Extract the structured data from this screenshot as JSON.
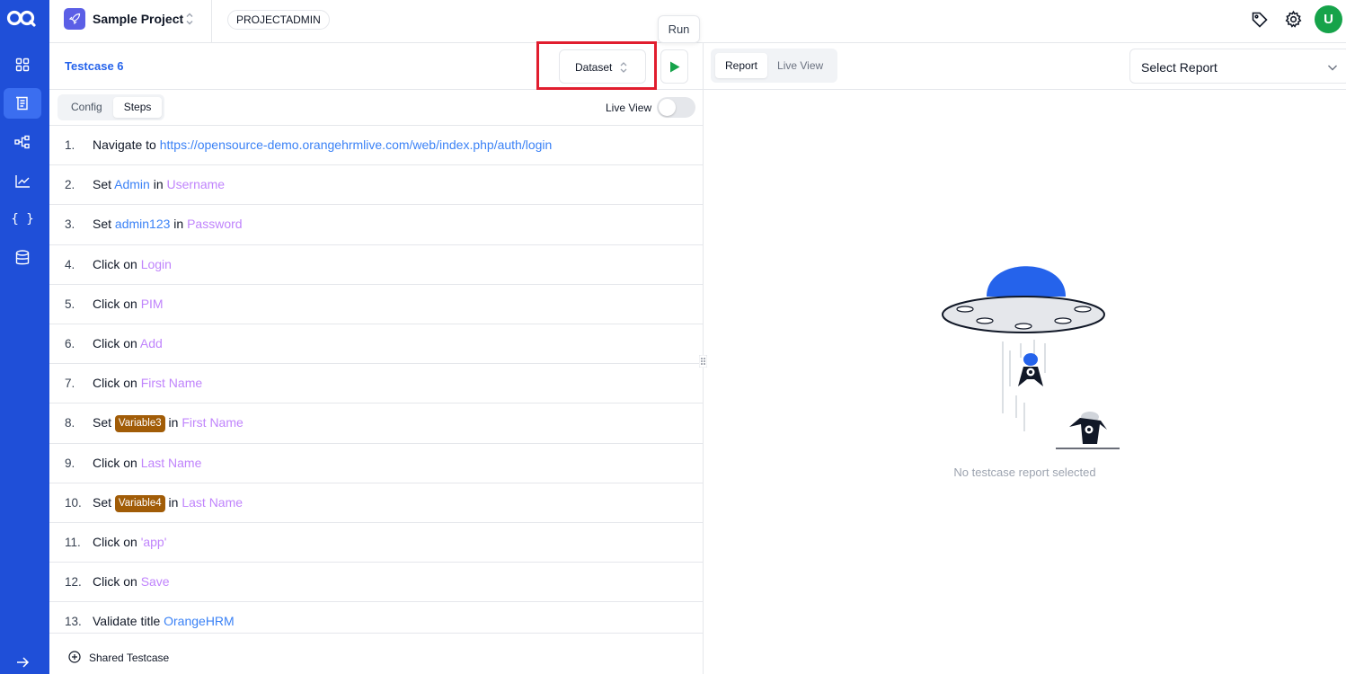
{
  "sidebar": {
    "items": [
      {
        "icon": "dashboard-grid-icon"
      },
      {
        "icon": "testcase-list-icon",
        "active": true
      },
      {
        "icon": "workflow-icon"
      },
      {
        "icon": "analytics-chart-icon"
      },
      {
        "icon": "braces-icon",
        "label": "{ }"
      },
      {
        "icon": "database-icon"
      }
    ],
    "expand_icon": "arrow-right-icon"
  },
  "header": {
    "project_name": "Sample Project",
    "role": "PROJECTADMIN",
    "avatar_initial": "U"
  },
  "testcase": {
    "title": "Testcase 6",
    "dataset_label": "Dataset",
    "run_tooltip": "Run"
  },
  "tabs": {
    "config": "Config",
    "steps": "Steps",
    "live_view_label": "Live View"
  },
  "steps": [
    {
      "num": "1.",
      "parts": [
        {
          "t": "Navigate to ",
          "c": ""
        },
        {
          "t": "https://opensource-demo.orangehrmlive.com/web/index.php/auth/login",
          "c": "blue"
        }
      ]
    },
    {
      "num": "2.",
      "parts": [
        {
          "t": "Set ",
          "c": ""
        },
        {
          "t": "Admin",
          "c": "blue"
        },
        {
          "t": " in ",
          "c": ""
        },
        {
          "t": "Username",
          "c": "purple"
        }
      ]
    },
    {
      "num": "3.",
      "parts": [
        {
          "t": "Set ",
          "c": ""
        },
        {
          "t": "admin123",
          "c": "blue"
        },
        {
          "t": " in ",
          "c": ""
        },
        {
          "t": "Password",
          "c": "purple"
        }
      ]
    },
    {
      "num": "4.",
      "parts": [
        {
          "t": "Click on ",
          "c": ""
        },
        {
          "t": "Login",
          "c": "purple"
        }
      ]
    },
    {
      "num": "5.",
      "parts": [
        {
          "t": "Click on ",
          "c": ""
        },
        {
          "t": "PIM",
          "c": "purple"
        }
      ]
    },
    {
      "num": "6.",
      "parts": [
        {
          "t": "Click on ",
          "c": ""
        },
        {
          "t": "Add",
          "c": "purple"
        }
      ]
    },
    {
      "num": "7.",
      "parts": [
        {
          "t": "Click on ",
          "c": ""
        },
        {
          "t": "First Name",
          "c": "purple"
        }
      ]
    },
    {
      "num": "8.",
      "parts": [
        {
          "t": "Set ",
          "c": ""
        },
        {
          "t": "Variable3",
          "c": "var"
        },
        {
          "t": " in ",
          "c": ""
        },
        {
          "t": "First Name",
          "c": "purple"
        }
      ]
    },
    {
      "num": "9.",
      "parts": [
        {
          "t": "Click on ",
          "c": ""
        },
        {
          "t": "Last Name",
          "c": "purple"
        }
      ]
    },
    {
      "num": "10.",
      "parts": [
        {
          "t": "Set ",
          "c": ""
        },
        {
          "t": "Variable4",
          "c": "var"
        },
        {
          "t": " in ",
          "c": ""
        },
        {
          "t": "Last Name",
          "c": "purple"
        }
      ]
    },
    {
      "num": "11.",
      "parts": [
        {
          "t": "Click on ",
          "c": ""
        },
        {
          "t": "'app'",
          "c": "purple"
        }
      ]
    },
    {
      "num": "12.",
      "parts": [
        {
          "t": "Click on ",
          "c": ""
        },
        {
          "t": "Save",
          "c": "purple"
        }
      ]
    },
    {
      "num": "13.",
      "parts": [
        {
          "t": "Validate title ",
          "c": ""
        },
        {
          "t": "OrangeHRM",
          "c": "blue"
        }
      ]
    }
  ],
  "footer": {
    "shared_testcase": "Shared Testcase"
  },
  "report": {
    "tab_report": "Report",
    "tab_live_view": "Live View",
    "select_placeholder": "Select Report",
    "empty_text": "No testcase report selected"
  },
  "colors": {
    "sidebar": "#1f4fd8",
    "accent_blue": "#2563eb",
    "run_green": "#16a34a",
    "variable_badge": "#a15c07",
    "element_purple": "#c084fc",
    "highlight_red": "#e11d2e"
  }
}
